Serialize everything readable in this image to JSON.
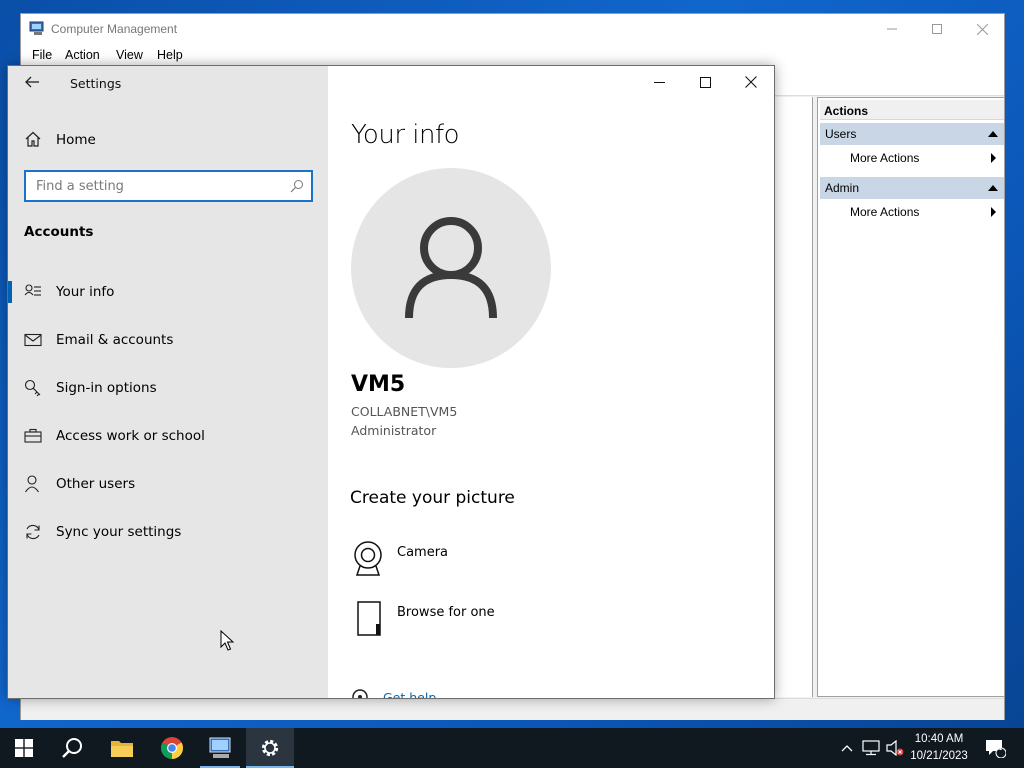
{
  "computer_management": {
    "title": "Computer Management",
    "menu": [
      "File",
      "Action",
      "View",
      "Help"
    ],
    "actions_pane": {
      "header": "Actions",
      "groups": [
        {
          "label": "Users",
          "item": "More Actions"
        },
        {
          "label": "Admin",
          "item": "More Actions"
        }
      ]
    }
  },
  "settings": {
    "title": "Settings",
    "nav": {
      "home": "Home",
      "search_placeholder": "Find a setting",
      "section": "Accounts",
      "items": [
        {
          "label": "Your info",
          "icon": "contact-card-icon",
          "selected": true
        },
        {
          "label": "Email & accounts",
          "icon": "mail-icon",
          "selected": false
        },
        {
          "label": "Sign-in options",
          "icon": "key-icon",
          "selected": false
        },
        {
          "label": "Access work or school",
          "icon": "briefcase-icon",
          "selected": false
        },
        {
          "label": "Other users",
          "icon": "person-icon",
          "selected": false
        },
        {
          "label": "Sync your settings",
          "icon": "sync-icon",
          "selected": false
        }
      ]
    },
    "content": {
      "page_title": "Your info",
      "user_name": "VM5",
      "account": "COLLABNET\\VM5",
      "role": "Administrator",
      "create_heading": "Create your picture",
      "options": [
        {
          "label": "Camera",
          "icon": "camera-icon"
        },
        {
          "label": "Browse for one",
          "icon": "browse-icon"
        }
      ],
      "help_link": "Get help"
    }
  },
  "taskbar": {
    "apps": [
      "start",
      "search",
      "file-explorer",
      "chrome",
      "computer-management",
      "settings"
    ],
    "time": "10:40 AM",
    "date": "10/21/2023",
    "notification_count": "1"
  },
  "colors": {
    "accent": "#0063b1",
    "search_border": "#1b73c7",
    "nav_background": "#e6e6e6",
    "actions_group_bg": "#c9d6e6",
    "taskbar": "#101820"
  }
}
